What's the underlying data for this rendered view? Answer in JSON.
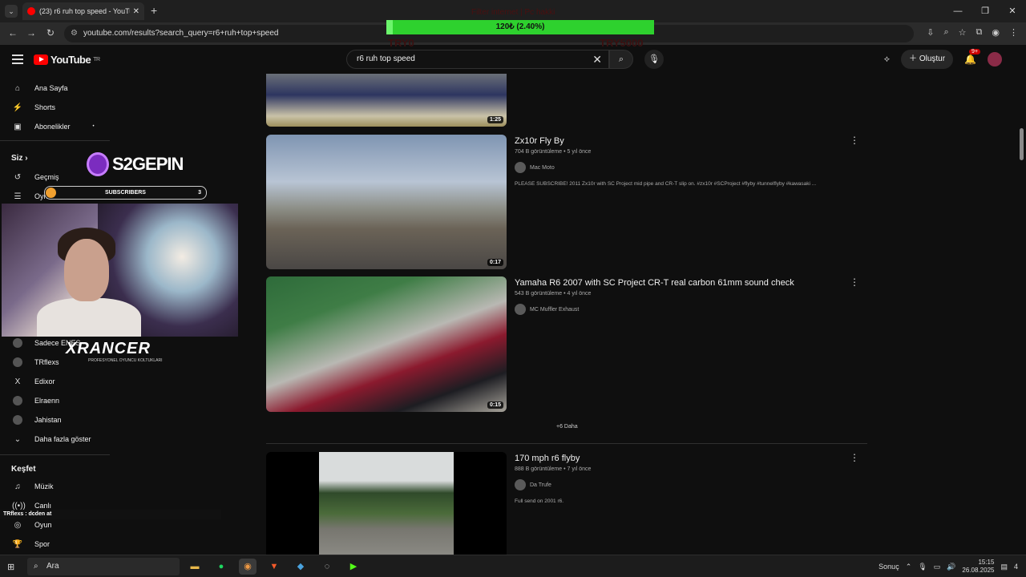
{
  "browser": {
    "tab_title": "(23) r6 ruh top speed - YouTub",
    "tab_close": "✕",
    "new_tab": "+",
    "tab_menu": "⌄",
    "url": "youtube.com/results?search_query=r6+ruh+top+speed",
    "window_controls": [
      "—",
      "❐",
      "✕"
    ],
    "nav": {
      "back": "←",
      "forward": "→",
      "reload": "↻"
    }
  },
  "overlay": {
    "filter_text": "Filter internet | Pc hakki",
    "progress_label": "120₺ (2.40%)",
    "progress_fraction": 0.024,
    "try_left": "TRY0",
    "try_right": "TRY5000",
    "brand1": "S2GEPIN",
    "subscribers_label": "SUBSCRIBERS",
    "subscribers_count": "3",
    "brand2_main": "XRANCER",
    "brand2_tag": "PROFESYONEL OYUNCU KOLTUKLARI",
    "chat_line": "TRflexs : dcden at"
  },
  "youtube": {
    "logo_text": "YouTube",
    "logo_region": "TR",
    "search_value": "r6 ruh top speed",
    "create_label": "Oluştur",
    "notif_count": "9+"
  },
  "sidebar": {
    "home": "Ana Sayfa",
    "shorts": "Shorts",
    "subs": "Abonelikler",
    "you_head": "Siz",
    "history": "Geçmiş",
    "playlists": "Oynatma listeleri",
    "channels": [
      "Sadece ENES",
      "TRflexs",
      "Edixor",
      "Elraenn",
      "Jahistan"
    ],
    "show_more": "Daha fazla göster",
    "explore_head": "Keşfet",
    "music": "Müzik",
    "live": "Canlı",
    "gaming": "Oyun",
    "sports": "Spor"
  },
  "results": [
    {
      "duration": "1:25"
    },
    {
      "title": "Zx10r Fly By",
      "sub": "704 B görüntüleme • 5 yıl önce",
      "channel": "Mac Moto",
      "desc": "PLEASE SUBSCRIBE! 2011 Zx10r with SC Project mid pipe and CR-T slip on. #zx10r #SCProject #flyby #tunnelflyby #kawasaki ...",
      "duration": "0:17"
    },
    {
      "title": "Yamaha R6 2007 with SC Project CR-T real carbon 61mm sound check",
      "sub": "543 B görüntüleme • 4 yıl önce",
      "channel": "MC Muffler Exhaust",
      "desc": "",
      "duration": "0:15"
    },
    {
      "title": "170 mph r6 flyby",
      "sub": "888 B görüntüleme • 7 yıl önce",
      "channel": "Da Trufe",
      "desc": "Full send on 2001 r6.",
      "duration": ""
    }
  ],
  "more_label": "+6 Daha",
  "taskbar": {
    "search_placeholder": "Ara",
    "weather": "Sonuç",
    "time": "15:15",
    "date": "26.08.2025",
    "notif": "4"
  }
}
